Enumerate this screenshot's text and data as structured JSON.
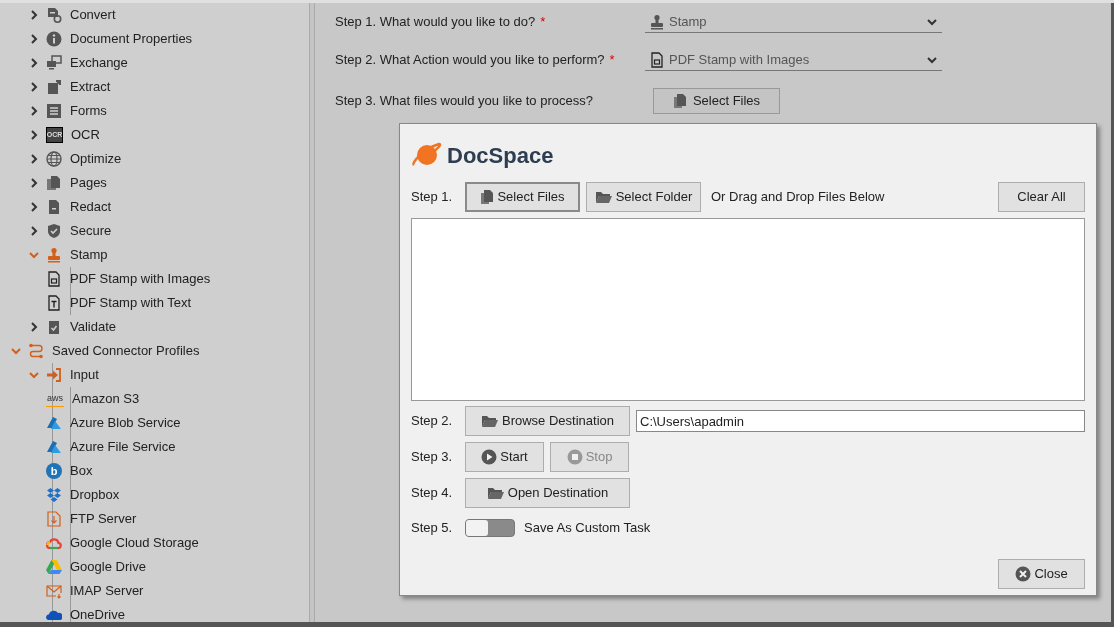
{
  "sidebar": {
    "tree": [
      {
        "children": [
          {
            "label": "Convert",
            "expanded": false
          },
          {
            "label": "Document Properties",
            "expanded": false
          },
          {
            "label": "Exchange",
            "expanded": false
          },
          {
            "label": "Extract",
            "expanded": false
          },
          {
            "label": "Forms",
            "expanded": false
          },
          {
            "label": "OCR",
            "icon_text": "OCR",
            "expanded": false
          },
          {
            "label": "Optimize",
            "expanded": false
          },
          {
            "label": "Pages",
            "expanded": false
          },
          {
            "label": "Redact",
            "expanded": false
          },
          {
            "label": "Secure",
            "expanded": false
          },
          {
            "label": "Stamp",
            "expanded": true,
            "children": [
              {
                "label": "PDF Stamp with Images"
              },
              {
                "label": "PDF Stamp with Text"
              }
            ]
          },
          {
            "label": "Validate",
            "expanded": false
          }
        ]
      },
      {
        "label": "Saved Connector Profiles",
        "expanded": true,
        "children": [
          {
            "label": "Input",
            "expanded": true,
            "children": [
              {
                "label": "Amazon S3",
                "icon_text": "aws"
              },
              {
                "label": "Azure Blob Service"
              },
              {
                "label": "Azure File Service"
              },
              {
                "label": "Box",
                "icon_text": "b"
              },
              {
                "label": "Dropbox"
              },
              {
                "label": "FTP Server"
              },
              {
                "label": "Google Cloud Storage"
              },
              {
                "label": "Google Drive"
              },
              {
                "label": "IMAP Server"
              },
              {
                "label": "OneDrive"
              }
            ]
          }
        ]
      }
    ]
  },
  "form": {
    "steps": [
      {
        "kind": "dropdown",
        "label": "Step 1. What would you like to do?",
        "required_mark": "*",
        "value": "Stamp"
      },
      {
        "kind": "dropdown",
        "label": "Step 2. What Action would you like to perform?",
        "required_mark": "*",
        "value": "PDF Stamp with Images"
      },
      {
        "kind": "button",
        "label": "Step 3. What files would you like to process?",
        "value": "Select Files"
      }
    ]
  },
  "dialog": {
    "logo": "DocSpace",
    "step1": {
      "label": "Step 1.",
      "select_files": "Select Files",
      "select_folder": "Select Folder",
      "hint": "Or Drag and Drop Files Below",
      "clear_all": "Clear All"
    },
    "step2": {
      "label": "Step 2.",
      "browse": "Browse Destination",
      "path": "C:\\Users\\apadmin"
    },
    "step3": {
      "label": "Step 3.",
      "start": {
        "label": "Start",
        "disabled": false
      },
      "stop": {
        "label": "Stop",
        "disabled": true
      }
    },
    "step4": {
      "label": "Step 4.",
      "open": "Open Destination"
    },
    "step5": {
      "label": "Step 5.",
      "toggle": {
        "on": false
      },
      "text": "Save As Custom Task"
    },
    "close": "Close"
  }
}
